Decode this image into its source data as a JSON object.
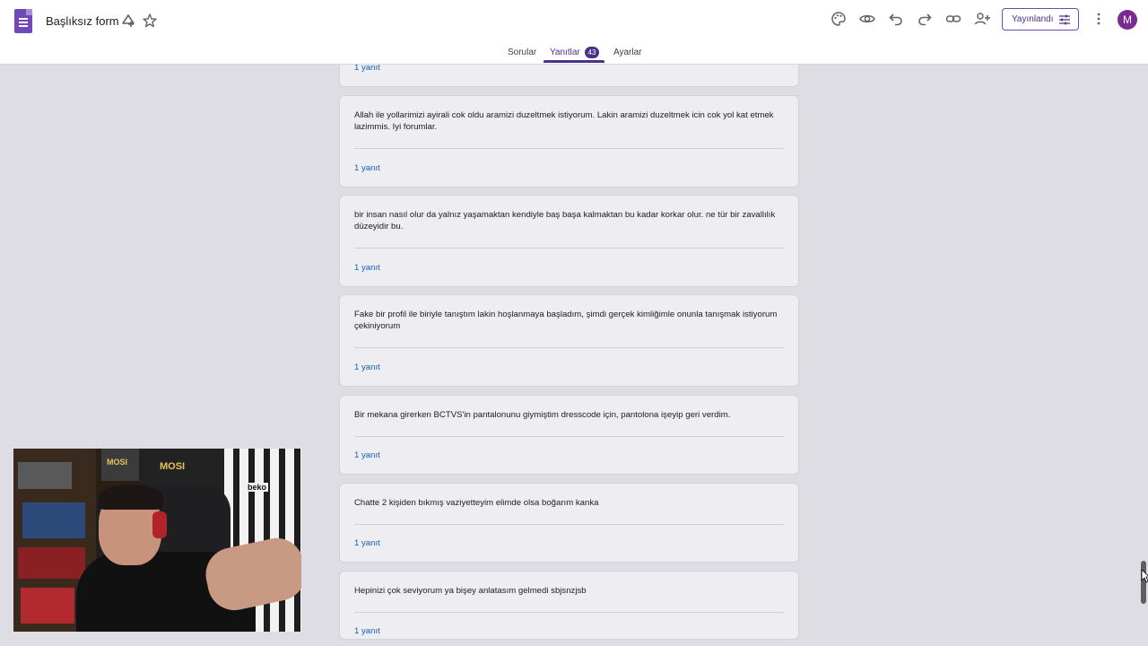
{
  "header": {
    "title": "Başlıksız form",
    "publish_label": "Yayınlandı",
    "avatar_letter": "M"
  },
  "tabs": [
    {
      "label": "Sorular"
    },
    {
      "label": "Yanıtlar",
      "badge": "43"
    },
    {
      "label": "Ayarlar"
    }
  ],
  "cards": [
    {
      "text": "",
      "link": "1 yanıt"
    },
    {
      "text": "Allah ile yollarimizi ayirali cok oldu aramizi duzeltmek istiyorum. Lakin aramizi duzeltmek icin cok yol kat etmek lazimmis. Iyi forumlar.",
      "link": "1 yanıt"
    },
    {
      "text": "bir insan nasıl olur da yalnız yaşamaktan kendiyle baş başa kalmaktan bu kadar korkar olur. ne tür bir zavallılık düzeyidir bu.",
      "link": "1 yanıt"
    },
    {
      "text": "Fake bir profil ile biriyle tanıştım lakin hoşlanmaya başladım, şimdi gerçek kimliğimle onunla tanışmak istiyorum çekiniyorum",
      "link": "1 yanıt"
    },
    {
      "text": "Bir mekana girerken BCTVS'in pantalonunu giymiştim dresscode için, pantolona işeyip geri verdim.",
      "link": "1 yanıt"
    },
    {
      "text": "Chatte 2 kişiden bıkmış vaziyetteyim elimde olsa boğarım kanka",
      "link": "1 yanıt"
    },
    {
      "text": "Hepinizi çok seviyorum ya bişey anlatasım gelmedi sbjsnzjsb",
      "link": "1 yanıt"
    }
  ],
  "webcam": {
    "label_mosi_1": "MOSI",
    "label_mosi_2": "MOSI",
    "label_beko": "beko"
  },
  "colors": {
    "accent": "#4b2f8a",
    "background": "#dedde3",
    "card": "#eeedf1",
    "link": "#1a5fb4"
  }
}
